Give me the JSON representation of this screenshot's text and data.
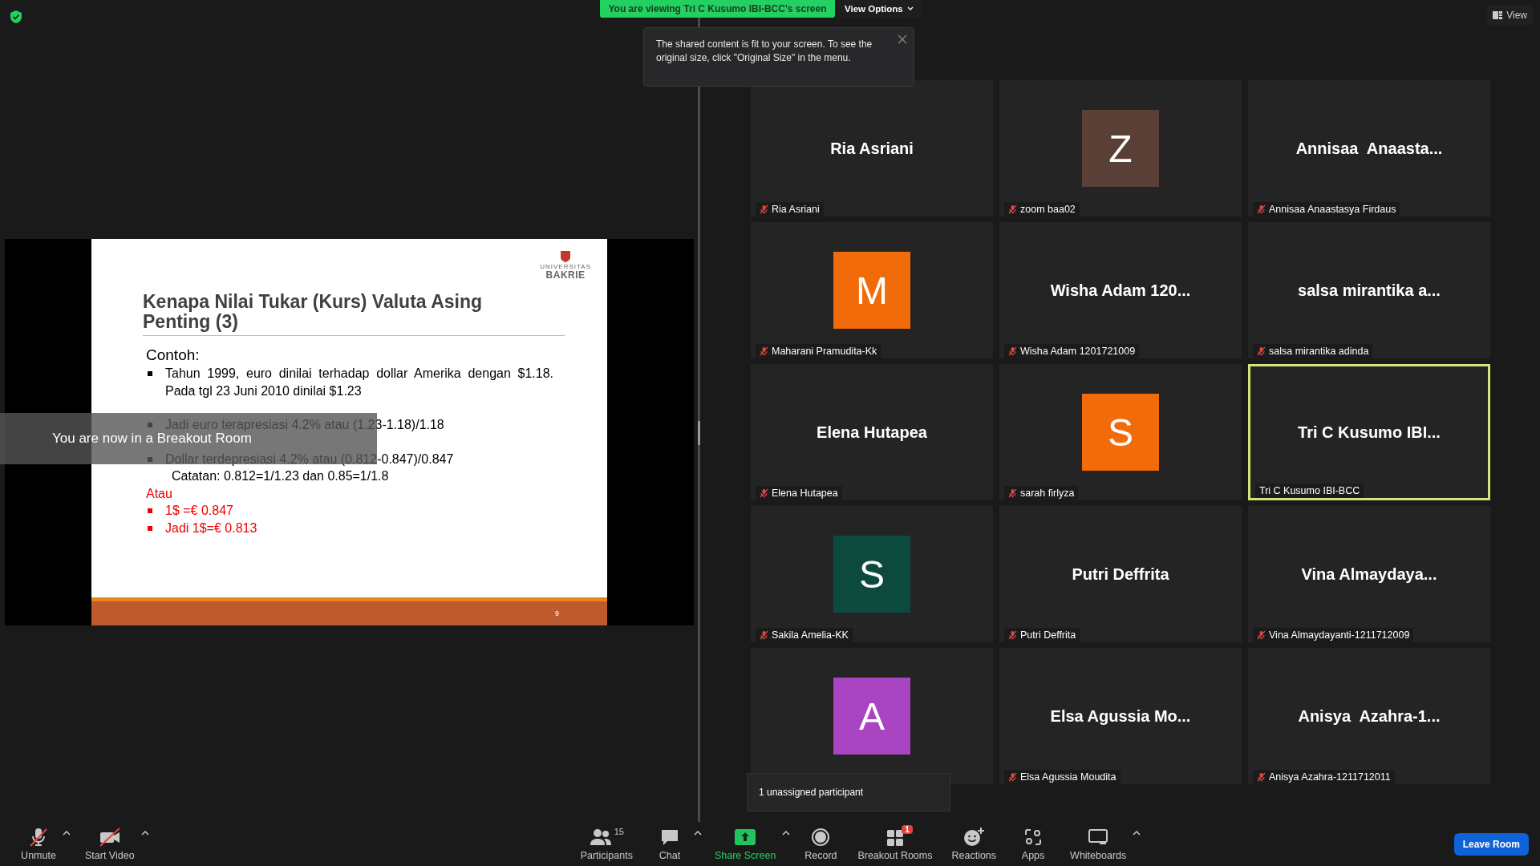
{
  "sharing_banner": "You are viewing Tri C Kusumo IBI-BCC's screen",
  "view_options": "View Options",
  "view_button": "View",
  "tooltip": {
    "text": "The shared content is fit to your screen. To see the original size, click \"Original Size\" in the menu."
  },
  "slide": {
    "logo_top": "UNIVERSITAS",
    "logo": "BAKRIE",
    "title": "Kenapa Nilai Tukar (Kurs) Valuta Asing Penting  (3)",
    "heading": "Contoh:",
    "page": "9",
    "items": [
      {
        "kind": "bullet",
        "text": "Tahun 1999, euro dinilai terhadap dollar Amerika dengan $1.18. Pada tgl 23 Juni 2010 dinilai $1.23",
        "color": "#000000"
      },
      {
        "kind": "gap"
      },
      {
        "kind": "bullet",
        "text": "Jadi euro terapresiasi 4.2% atau (1.23-1.18)/1.18",
        "color": "#000000"
      },
      {
        "kind": "gap"
      },
      {
        "kind": "bullet",
        "text": "Dollar terdepresiasi 4.2% atau (0.812-0.847)/0.847",
        "color": "#000000"
      },
      {
        "kind": "indent",
        "text": "Catatan: 0.812=1/1.23 dan 0.85=1/1.8",
        "color": "#000000"
      },
      {
        "kind": "plain",
        "text": "Atau",
        "color": "#ee0000"
      },
      {
        "kind": "bullet",
        "text": "1$ =€ 0.847",
        "color": "#ee0000"
      },
      {
        "kind": "bullet",
        "text": "Jadi   1$=€ 0.813",
        "color": "#ee0000"
      }
    ]
  },
  "breakout_notice": "You are now in a Breakout Room",
  "tiles": [
    {
      "display": "Ria Asriani",
      "name": "Ria Asriani",
      "muted": true,
      "speaking": false
    },
    {
      "avatar": "Z",
      "color": "#5a3f37",
      "name": "zoom baa02",
      "muted": true,
      "speaking": false
    },
    {
      "display": "Annisaa  Anaasta...",
      "name": "Annisaa Anaastasya Firdaus",
      "muted": true,
      "speaking": false
    },
    {
      "avatar": "M",
      "color": "#f26b0a",
      "name": "Maharani Pramudita-Kk",
      "muted": true,
      "speaking": false
    },
    {
      "display": "Wisha Adam 120...",
      "name": "Wisha Adam 1201721009",
      "muted": true,
      "speaking": false
    },
    {
      "display": "salsa mirantika a...",
      "name": "salsa mirantika adinda",
      "muted": true,
      "speaking": false
    },
    {
      "display": "Elena Hutapea",
      "name": "Elena Hutapea",
      "muted": true,
      "speaking": false
    },
    {
      "avatar": "S",
      "color": "#f26b0a",
      "name": "sarah firlyza",
      "muted": true,
      "speaking": false
    },
    {
      "display": "Tri C Kusumo IBI...",
      "name": "Tri C Kusumo IBI-BCC",
      "muted": false,
      "speaking": true
    },
    {
      "avatar": "S",
      "color": "#0c4a3e",
      "name": "Sakila Amelia-KK",
      "muted": true,
      "speaking": false
    },
    {
      "display": "Putri Deffrita",
      "name": "Putri Deffrita",
      "muted": true,
      "speaking": false
    },
    {
      "display": "Vina Almaydaya...",
      "name": "Vina Almaydayanti-1211712009",
      "muted": true,
      "speaking": false
    },
    {
      "avatar": "A",
      "color": "#a944c2",
      "speaking": false
    },
    {
      "display": "Elsa Agussia Mo...",
      "name": "Elsa Agussia Moudita",
      "muted": true,
      "speaking": false
    },
    {
      "display": "Anisya  Azahra-1...",
      "name": "Anisya Azahra-1211712011",
      "muted": true,
      "speaking": false
    }
  ],
  "unassigned_popup": "1 unassigned participant",
  "toolbar": {
    "left": [
      {
        "kind": "mic",
        "label": "Unmute",
        "caret": true,
        "active": false
      },
      {
        "kind": "video",
        "label": "Start Video",
        "caret": true,
        "active": false
      }
    ],
    "center": [
      {
        "kind": "participants",
        "label": "Participants",
        "count": "15",
        "caret": false,
        "active": false
      },
      {
        "kind": "chat",
        "label": "Chat",
        "caret": true,
        "active": false
      },
      {
        "kind": "share",
        "label": "Share Screen",
        "caret": true,
        "active": true
      },
      {
        "kind": "record",
        "label": "Record",
        "caret": false,
        "active": false
      },
      {
        "kind": "breakout",
        "label": "Breakout Rooms",
        "badge": "1",
        "caret": false,
        "active": false
      },
      {
        "kind": "reactions",
        "label": "Reactions",
        "caret": false,
        "active": false
      },
      {
        "kind": "apps",
        "label": "Apps",
        "caret": false,
        "active": false
      },
      {
        "kind": "whiteboard",
        "label": "Whiteboards",
        "caret": true,
        "active": false
      }
    ],
    "leave": "Leave Room"
  }
}
